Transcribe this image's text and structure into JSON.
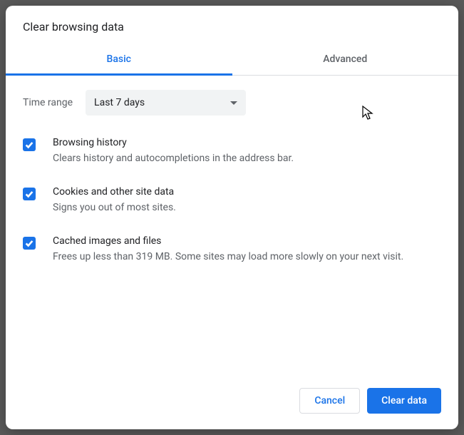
{
  "dialog": {
    "title": "Clear browsing data",
    "tabs": {
      "basic": "Basic",
      "advanced": "Advanced"
    },
    "time_range": {
      "label": "Time range",
      "selected": "Last 7 days"
    },
    "options": [
      {
        "title": "Browsing history",
        "desc": "Clears history and autocompletions in the address bar."
      },
      {
        "title": "Cookies and other site data",
        "desc": "Signs you out of most sites."
      },
      {
        "title": "Cached images and files",
        "desc": "Frees up less than 319 MB. Some sites may load more slowly on your next visit."
      }
    ],
    "buttons": {
      "cancel": "Cancel",
      "clear": "Clear data"
    }
  }
}
